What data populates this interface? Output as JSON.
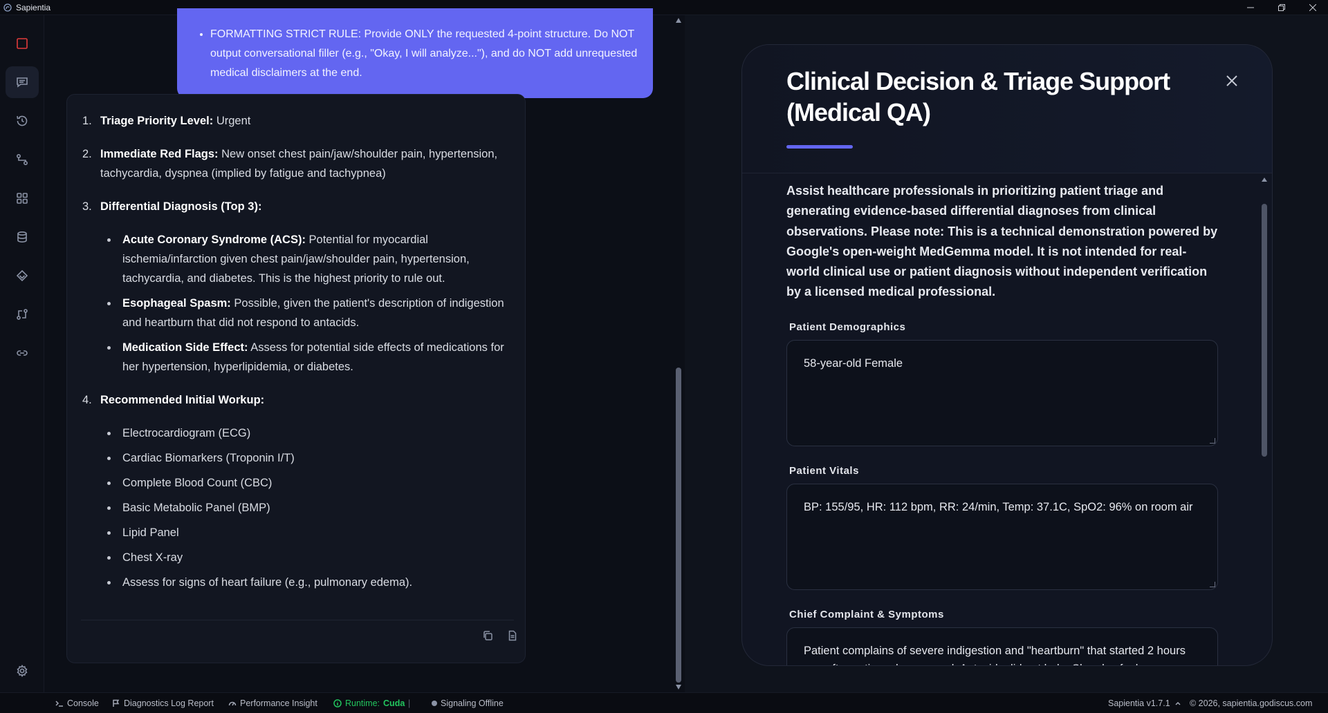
{
  "window": {
    "title": "Sapientia"
  },
  "chat": {
    "user_message_bullet": "FORMATTING STRICT RULE: Provide ONLY the requested 4-point structure. Do NOT output conversational filler (e.g., \"Okay, I will analyze...\"), and do NOT add unrequested medical disclaimers at the end.",
    "answer": {
      "item1_num": "1.",
      "item1_label": "Triage Priority Level:",
      "item1_value": " Urgent",
      "item2_num": "2.",
      "item2_label": "Immediate Red Flags:",
      "item2_value": " New onset chest pain/jaw/shoulder pain, hypertension, tachycardia, dyspnea (implied by fatigue and tachypnea)",
      "item3_num": "3.",
      "item3_label": "Differential Diagnosis (Top 3):",
      "differentials": [
        {
          "label": "Acute Coronary Syndrome (ACS):",
          "text": " Potential for myocardial ischemia/infarction given chest pain/jaw/shoulder pain, hypertension, tachycardia, and diabetes. This is the highest priority to rule out."
        },
        {
          "label": "Esophageal Spasm:",
          "text": " Possible, given the patient's description of indigestion and heartburn that did not respond to antacids."
        },
        {
          "label": "Medication Side Effect:",
          "text": " Assess for potential side effects of medications for her hypertension, hyperlipidemia, or diabetes."
        }
      ],
      "item4_num": "4.",
      "item4_label": "Recommended Initial Workup:",
      "workup": [
        "Electrocardiogram (ECG)",
        "Cardiac Biomarkers (Troponin I/T)",
        "Complete Blood Count (CBC)",
        "Basic Metabolic Panel (BMP)",
        "Lipid Panel",
        "Chest X-ray",
        "Assess for signs of heart failure (e.g., pulmonary edema)."
      ]
    }
  },
  "panel": {
    "title": "Clinical Decision & Triage Support (Medical QA)",
    "description": "Assist healthcare professionals in prioritizing patient triage and generating evidence-based differential diagnoses from clinical observations. Please note: This is a technical demonstration powered by Google's open-weight MedGemma model. It is not intended for real-world clinical use or patient diagnosis without independent verification by a licensed medical professional.",
    "fields": {
      "demographics_label": "Patient Demographics",
      "demographics_value": "58-year-old Female",
      "vitals_label": "Patient Vitals",
      "vitals_value": "BP: 155/95, HR: 112 bpm, RR: 24/min, Temp: 37.1C, SpO2: 96% on room air",
      "complaint_label": "Chief Complaint & Symptoms",
      "complaint_value": "Patient complains of severe indigestion and \"heartburn\" that started 2 hours ago after eating a heavy meal. Antacids did not help. She also feels"
    }
  },
  "statusbar": {
    "console": "Console",
    "diagnostics": "Diagnostics Log Report",
    "performance": "Performance Insight",
    "runtime_label": "Runtime:",
    "runtime_value": "Cuda",
    "signaling": "Signaling Offline",
    "version": "Sapientia v1.7.1",
    "copyright": "© 2026, sapientia.godiscus.com"
  },
  "colors": {
    "accent": "#6366f1",
    "stop": "#e23b3b",
    "runtime_ok": "#22c55e"
  }
}
